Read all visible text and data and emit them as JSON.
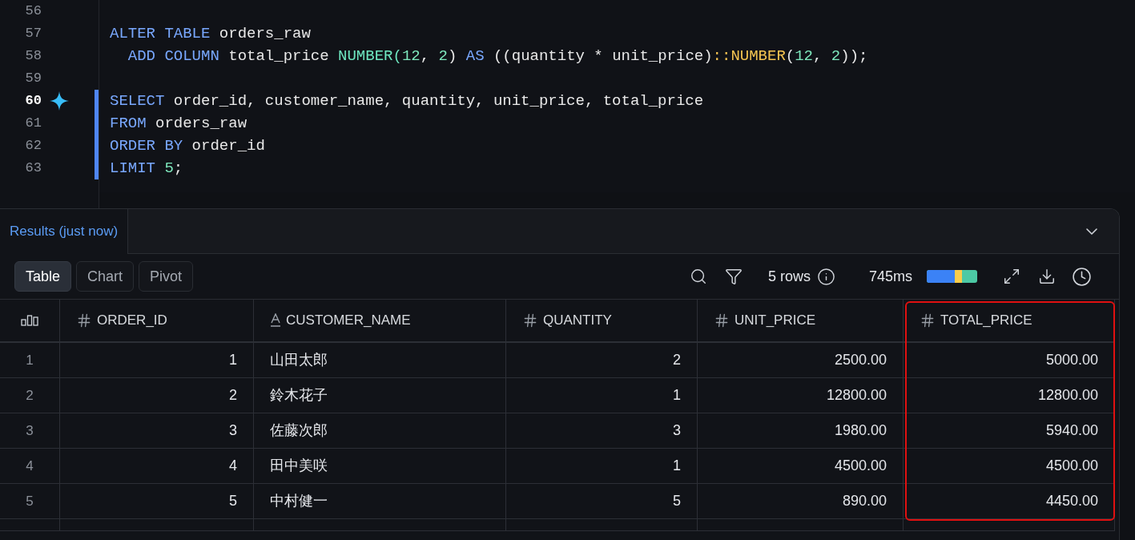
{
  "editor": {
    "lines": [
      {
        "number": "56",
        "selected": false,
        "highlighted": false
      },
      {
        "number": "57",
        "selected": false,
        "highlighted": false,
        "tokens": [
          {
            "text": "ALTER TABLE",
            "kind": "keyword"
          },
          {
            "text": " orders_raw",
            "kind": "plain"
          }
        ]
      },
      {
        "number": "58",
        "selected": false,
        "highlighted": false,
        "tokens": [
          {
            "text": "  ADD COLUMN",
            "kind": "keyword"
          },
          {
            "text": " total_price ",
            "kind": "plain"
          },
          {
            "text": "NUMBER(",
            "kind": "type"
          },
          {
            "text": "12",
            "kind": "number"
          },
          {
            "text": ", ",
            "kind": "plain"
          },
          {
            "text": "2",
            "kind": "number"
          },
          {
            "text": ") ",
            "kind": "plain"
          },
          {
            "text": "AS",
            "kind": "keyword"
          },
          {
            "text": " ((quantity * unit_price)",
            "kind": "plain"
          },
          {
            "text": "::NUMBER",
            "kind": "cast"
          },
          {
            "text": "(",
            "kind": "plain"
          },
          {
            "text": "12",
            "kind": "number"
          },
          {
            "text": ", ",
            "kind": "plain"
          },
          {
            "text": "2",
            "kind": "number"
          },
          {
            "text": "));",
            "kind": "plain"
          }
        ]
      },
      {
        "number": "59",
        "selected": false,
        "highlighted": false
      },
      {
        "number": "60",
        "selected": true,
        "highlighted": true,
        "tokens": [
          {
            "text": "SELECT",
            "kind": "keyword"
          },
          {
            "text": " order_id, customer_name, quantity, unit_price, total_price",
            "kind": "plain"
          }
        ]
      },
      {
        "number": "61",
        "selected": false,
        "highlighted": true,
        "tokens": [
          {
            "text": "FROM",
            "kind": "keyword"
          },
          {
            "text": " orders_raw",
            "kind": "plain"
          }
        ]
      },
      {
        "number": "62",
        "selected": false,
        "highlighted": true,
        "tokens": [
          {
            "text": "ORDER BY",
            "kind": "keyword"
          },
          {
            "text": " order_id",
            "kind": "plain"
          }
        ]
      },
      {
        "number": "63",
        "selected": false,
        "highlighted": true,
        "tokens": [
          {
            "text": "LIMIT ",
            "kind": "keyword"
          },
          {
            "text": "5",
            "kind": "number"
          },
          {
            "text": ";",
            "kind": "plain"
          }
        ]
      }
    ]
  },
  "results": {
    "tabs": [
      {
        "label": "Results (just now)",
        "selected": true
      }
    ],
    "views": [
      {
        "label": "Table",
        "selected": true
      },
      {
        "label": "Chart",
        "selected": false
      },
      {
        "label": "Pivot",
        "selected": false
      }
    ],
    "row_count": "5 rows",
    "duration": "745ms",
    "table": {
      "columns": [
        {
          "label": "ORDER_ID",
          "kind": "number",
          "highlighted": false
        },
        {
          "label": "CUSTOMER_NAME",
          "kind": "text",
          "highlighted": false
        },
        {
          "label": "QUANTITY",
          "kind": "number",
          "highlighted": false
        },
        {
          "label": "UNIT_PRICE",
          "kind": "number",
          "highlighted": false
        },
        {
          "label": "TOTAL_PRICE",
          "kind": "number",
          "highlighted": true
        }
      ],
      "rows": [
        {
          "index": "1",
          "cells": [
            "1",
            "山田太郎",
            "2",
            "2500.00",
            "5000.00"
          ]
        },
        {
          "index": "2",
          "cells": [
            "2",
            "鈴木花子",
            "1",
            "12800.00",
            "12800.00"
          ]
        },
        {
          "index": "3",
          "cells": [
            "3",
            "佐藤次郎",
            "3",
            "1980.00",
            "5940.00"
          ]
        },
        {
          "index": "4",
          "cells": [
            "4",
            "田中美咲",
            "1",
            "4500.00",
            "4500.00"
          ]
        },
        {
          "index": "5",
          "cells": [
            "5",
            "中村健一",
            "5",
            "890.00",
            "4450.00"
          ]
        }
      ]
    }
  }
}
